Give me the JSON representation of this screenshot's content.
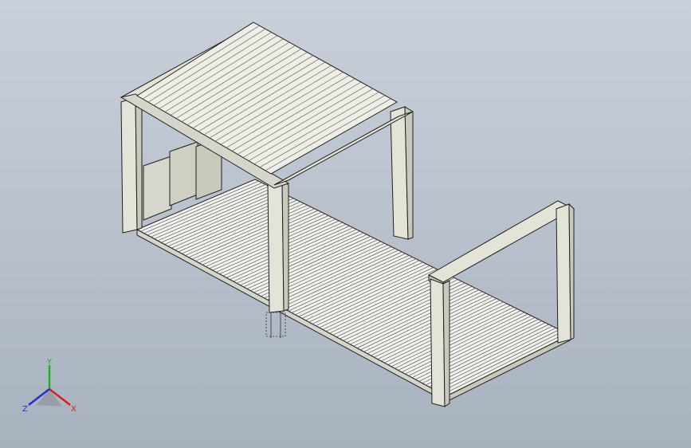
{
  "viewport": {
    "background_top": "#c9d0da",
    "background_bottom": "#a8b2bf"
  },
  "model": {
    "frame_color": "#e4e3d8",
    "frame_shade": "#c9c8bc",
    "edge_color": "#202020",
    "floor_color": "#f2f2ee"
  },
  "triad": {
    "x_label": "X",
    "y_label": "Y",
    "z_label": "Z",
    "x_color": "#d42020",
    "y_color": "#20b020",
    "z_color": "#2030d0"
  }
}
